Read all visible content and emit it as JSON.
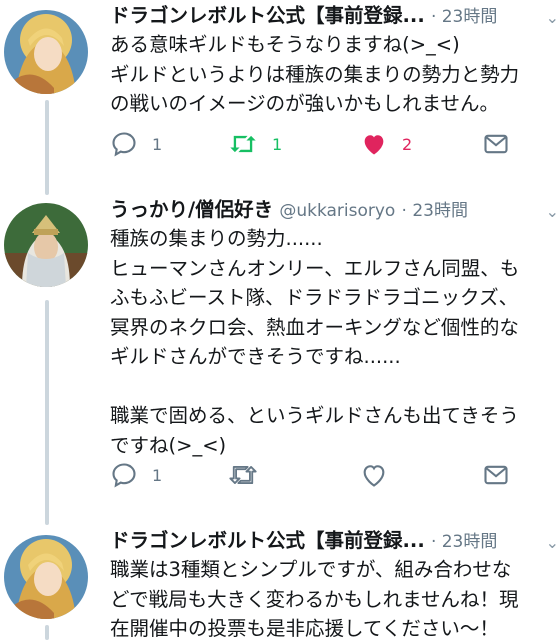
{
  "tweets": [
    {
      "name": "ドラゴンレボルト公式【事前登録...",
      "handle": "",
      "time": "· 23時間",
      "text": "ある意味ギルドもそうなりますね(>_<)\nギルドというよりは種族の集まりの勢力と勢力\nの戦いのイメージのが強いかもしれません。",
      "reply_count": "1",
      "retweet_count": "1",
      "like_count": "2",
      "retweeted": true,
      "liked": true
    },
    {
      "name": "うっかり/僧侶好き",
      "handle": "@ukkarisoryo",
      "time": "· 23時間",
      "text": "種族の集まりの勢力......\nヒューマンさんオンリー、エルフさん同盟、も\nふもふビースト隊、ドラドラドラゴニックズ、\n冥界のネクロ会、熱血オーキングなど個性的な\nギルドさんができそうですね......\n\n職業で固める、というギルドさんも出てきそう\nですね(>_<)",
      "reply_count": "1",
      "retweet_count": "",
      "like_count": "",
      "retweeted": false,
      "liked": false
    },
    {
      "name": "ドラゴンレボルト公式【事前登録...",
      "handle": "",
      "time": "· 23時間",
      "text": "職業は3種類とシンプルですが、組み合わせな\nどで戦局も大きく変わるかもしれませんね！現\n在開催中の投票も是非応援してください〜！",
      "reply_count": "",
      "retweet_count": "",
      "like_count": "",
      "retweeted": false,
      "liked": false
    }
  ],
  "colors": {
    "retweet_active": "#17bf63",
    "like_active": "#e0245e",
    "icon_default": "#657786",
    "thread_line": "#ccd6dd"
  },
  "icons": [
    "reply-icon",
    "retweet-icon",
    "like-icon",
    "dm-icon",
    "chevron-down-icon"
  ]
}
